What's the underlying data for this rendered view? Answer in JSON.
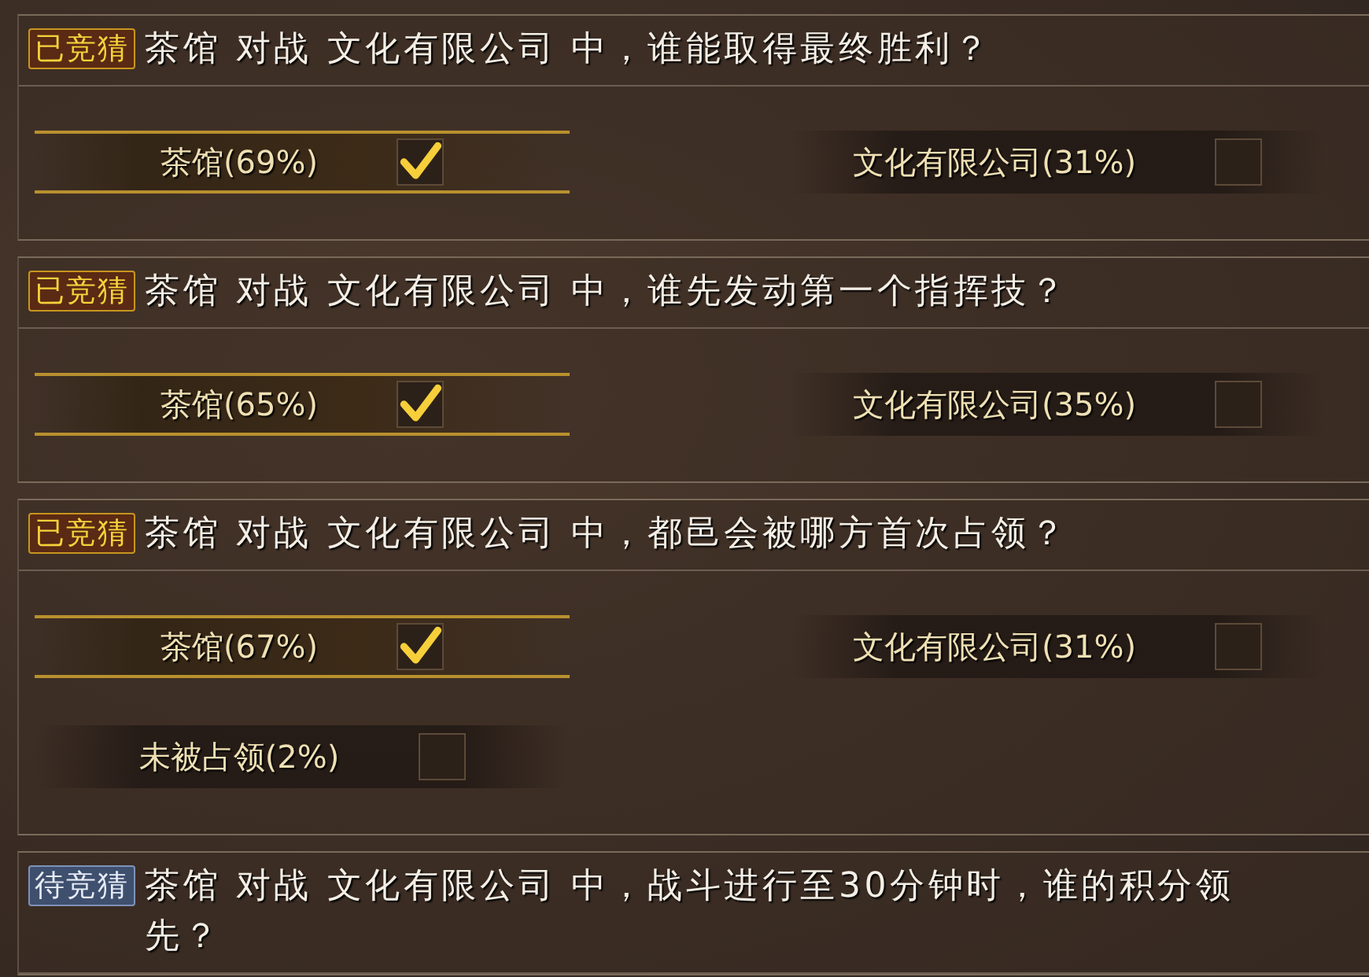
{
  "questions": [
    {
      "badge": {
        "kind": "guessed",
        "label": "已竞猜"
      },
      "text": "茶馆 对战 文化有限公司 中，谁能取得最终胜利？",
      "options": [
        {
          "label": "茶馆(69%)",
          "selected": true
        },
        {
          "label": "文化有限公司(31%)",
          "selected": false
        }
      ]
    },
    {
      "badge": {
        "kind": "guessed",
        "label": "已竞猜"
      },
      "text": "茶馆 对战 文化有限公司 中，谁先发动第一个指挥技？",
      "options": [
        {
          "label": "茶馆(65%)",
          "selected": true
        },
        {
          "label": "文化有限公司(35%)",
          "selected": false
        }
      ]
    },
    {
      "badge": {
        "kind": "guessed",
        "label": "已竞猜"
      },
      "text": "茶馆 对战 文化有限公司 中，都邑会被哪方首次占领？",
      "options": [
        {
          "label": "茶馆(67%)",
          "selected": true
        },
        {
          "label": "文化有限公司(31%)",
          "selected": false
        },
        {
          "label": "未被占领(2%)",
          "selected": false
        }
      ]
    },
    {
      "badge": {
        "kind": "pending",
        "label": "待竞猜"
      },
      "text": "茶馆 对战 文化有限公司 中，战斗进行至30分钟时，谁的积分领先？"
    }
  ]
}
